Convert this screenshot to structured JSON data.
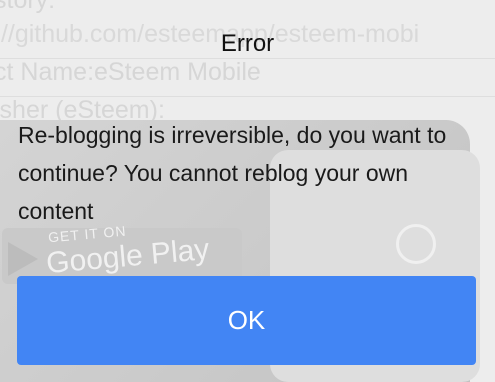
{
  "background": {
    "line1": "story:",
    "line2": "://github.com/esteemapp/esteem-mobi",
    "line3": "ct Name:eSteem Mobile",
    "line4": "isher (eSteem):",
    "badge_small": "GET IT ON",
    "badge_big": "Google Play"
  },
  "dialog": {
    "title": "Error",
    "message": "Re-blogging is irreversible, do you want to continue? You cannot reblog your own content",
    "ok_label": "OK"
  },
  "colors": {
    "accent": "#4285f4",
    "background": "#ededed"
  }
}
